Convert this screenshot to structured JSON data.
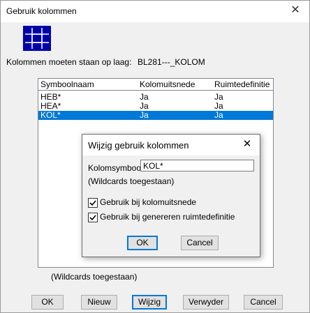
{
  "window": {
    "title": "Gebruik kolommen",
    "close_glyph": "✕"
  },
  "logo": {
    "icon": "grid-icon",
    "color": "#0000a8"
  },
  "layer": {
    "label": "Kolommen moeten staan op laag:",
    "value": "BL281---_KOLOM"
  },
  "list": {
    "headers": [
      "Symboolnaam",
      "Kolomuitsnede",
      "Ruimtedefinitie"
    ],
    "rows": [
      {
        "name": "HEB*",
        "kolomuitsnede": "Ja",
        "ruimtedefinitie": "Ja",
        "selected": false
      },
      {
        "name": "HEA*",
        "kolomuitsnede": "Ja",
        "ruimtedefinitie": "Ja",
        "selected": false
      },
      {
        "name": "KOL*",
        "kolomuitsnede": "Ja",
        "ruimtedefinitie": "Ja",
        "selected": true
      }
    ]
  },
  "wildcards_note": "(Wildcards toegestaan)",
  "buttons": {
    "ok": "OK",
    "nieuw": "Nieuw",
    "wijzig": "Wijzig",
    "verwyder": "Verwyder",
    "cancel": "Cancel"
  },
  "dialog": {
    "title": "Wijzig gebruik kolommen",
    "close_glyph": "✕",
    "symbol_label": "Kolomsymbool",
    "symbol_value": "KOL*",
    "wildcards_note": "(Wildcards toegestaan)",
    "check_kolomuitsnede": {
      "label": "Gebruik bij kolomuitsnede",
      "checked": true
    },
    "check_ruimtedefinitie": {
      "label": "Gebruik bij genereren ruimtedefinitie",
      "checked": true
    },
    "ok": "OK",
    "cancel": "Cancel"
  },
  "colors": {
    "selection": "#0078d7",
    "button_face": "#e1e1e1",
    "window_bg": "#f0f0f0"
  }
}
